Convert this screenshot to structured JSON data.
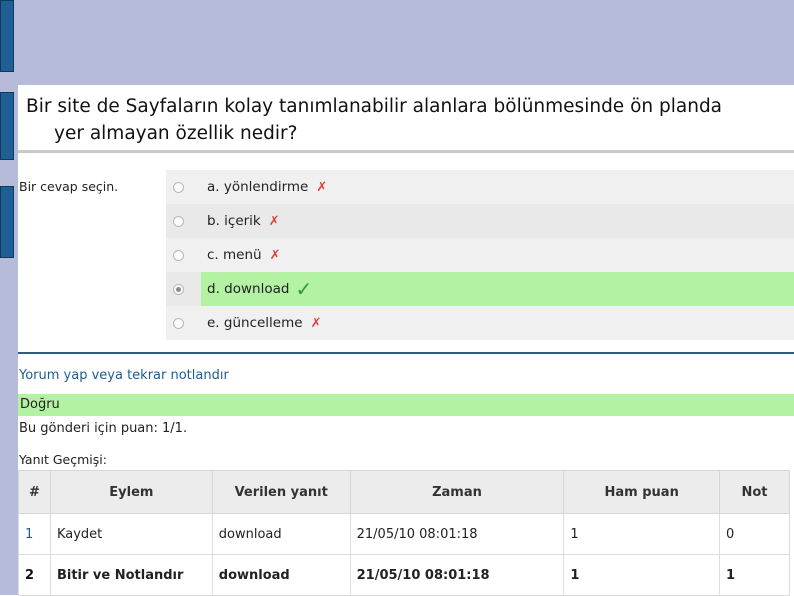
{
  "question": {
    "line1": "Bir site de Sayfaların kolay tanımlanabilir alanlara bölünmesinde ön planda",
    "line2": "yer almayan özellik nedir?"
  },
  "prompt": "Bir cevap seçin.",
  "answers": [
    {
      "label": "a. yönlendirme",
      "mark": "✗",
      "status": "incorrect",
      "selected": false
    },
    {
      "label": "b. içerik",
      "mark": "✗",
      "status": "incorrect",
      "selected": false
    },
    {
      "label": "c. menü",
      "mark": "✗",
      "status": "incorrect",
      "selected": false
    },
    {
      "label": "d. download",
      "mark": "✓",
      "status": "correct",
      "selected": true
    },
    {
      "label": "e. güncelleme",
      "mark": "✗",
      "status": "incorrect",
      "selected": false
    }
  ],
  "comment_link": "Yorum yap veya tekrar notlandır",
  "feedback": "Doğru",
  "score_text": "Bu gönderi için puan: 1/1.",
  "history": {
    "label": "Yanıt Geçmişi:",
    "headers": [
      "#",
      "Eylem",
      "Verilen yanıt",
      "Zaman",
      "Ham puan",
      "Not"
    ],
    "rows": [
      [
        "1",
        "Kaydet",
        "download",
        "21/05/10 08:01:18",
        "1",
        "0"
      ],
      [
        "2",
        "Bitir ve Notlandır",
        "download",
        "21/05/10 08:01:18",
        "1",
        "1"
      ]
    ]
  },
  "colors": {
    "band": "#b5bbd8",
    "tab": "#1f5f93",
    "correct_highlight": "#b3f2a3",
    "link": "#1d5d91",
    "incorrect_mark": "#e0403a",
    "correct_mark": "#2a9a3c"
  },
  "icons": {
    "incorrect": "cross-icon",
    "correct": "checkmark-icon",
    "radio": "radio-button"
  }
}
